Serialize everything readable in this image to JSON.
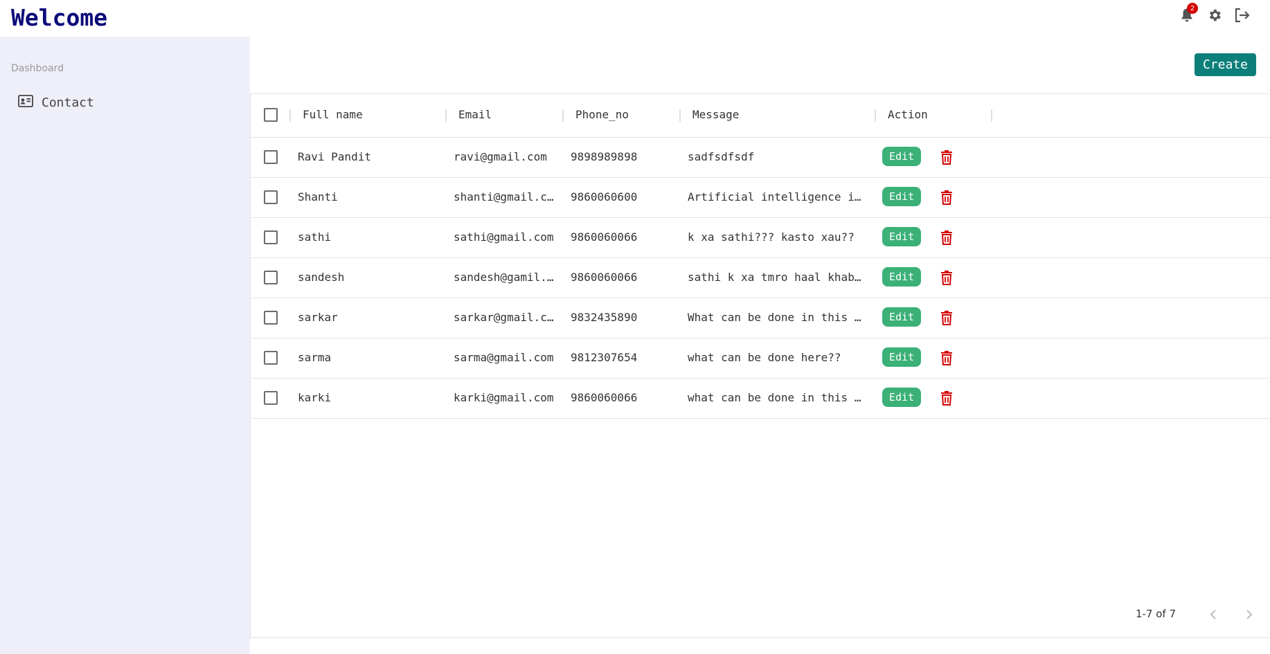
{
  "header": {
    "title": "Welcome",
    "icons": [
      "bell-icon",
      "gear-icon",
      "logout-icon"
    ],
    "notification_count": "2"
  },
  "sidebar": {
    "section_label": "Dashboard",
    "items": [
      {
        "label": "Contact",
        "icon": "contact-card-icon"
      }
    ]
  },
  "main": {
    "create_label": "Create",
    "table": {
      "columns": [
        "Full name",
        "Email",
        "Phone_no",
        "Message",
        "Action"
      ],
      "rows": [
        {
          "name": "Ravi Pandit",
          "email": "ravi@gmail.com",
          "phone": "9898989898",
          "message": "sadfsdfsdf"
        },
        {
          "name": "Shanti",
          "email": "shanti@gmail.c…",
          "phone": "9860060600",
          "message": "Artificial intelligence i…"
        },
        {
          "name": "sathi",
          "email": "sathi@gmail.com",
          "phone": "9860060066",
          "message": "k xa sathi??? kasto xau??"
        },
        {
          "name": "sandesh",
          "email": "sandesh@gamil.…",
          "phone": "9860060066",
          "message": "sathi k xa tmro haal khab…"
        },
        {
          "name": "sarkar",
          "email": "sarkar@gmail.c…",
          "phone": "9832435890",
          "message": "What can be done in this …"
        },
        {
          "name": "sarma",
          "email": "sarma@gmail.com",
          "phone": "9812307654",
          "message": "what can be done here??"
        },
        {
          "name": "karki",
          "email": "karki@gmail.com",
          "phone": "9860060066",
          "message": "what can be done in this …"
        }
      ],
      "edit_label": "Edit"
    },
    "pagination": {
      "text": "1-7 of 7"
    }
  },
  "colors": {
    "brand": "#0b0b7a",
    "sidebar_bg": "#eeeff8",
    "create_button": "#0d7f7a",
    "edit_button": "#3bb077",
    "delete_icon": "#d50000",
    "badge": "#d50000"
  }
}
